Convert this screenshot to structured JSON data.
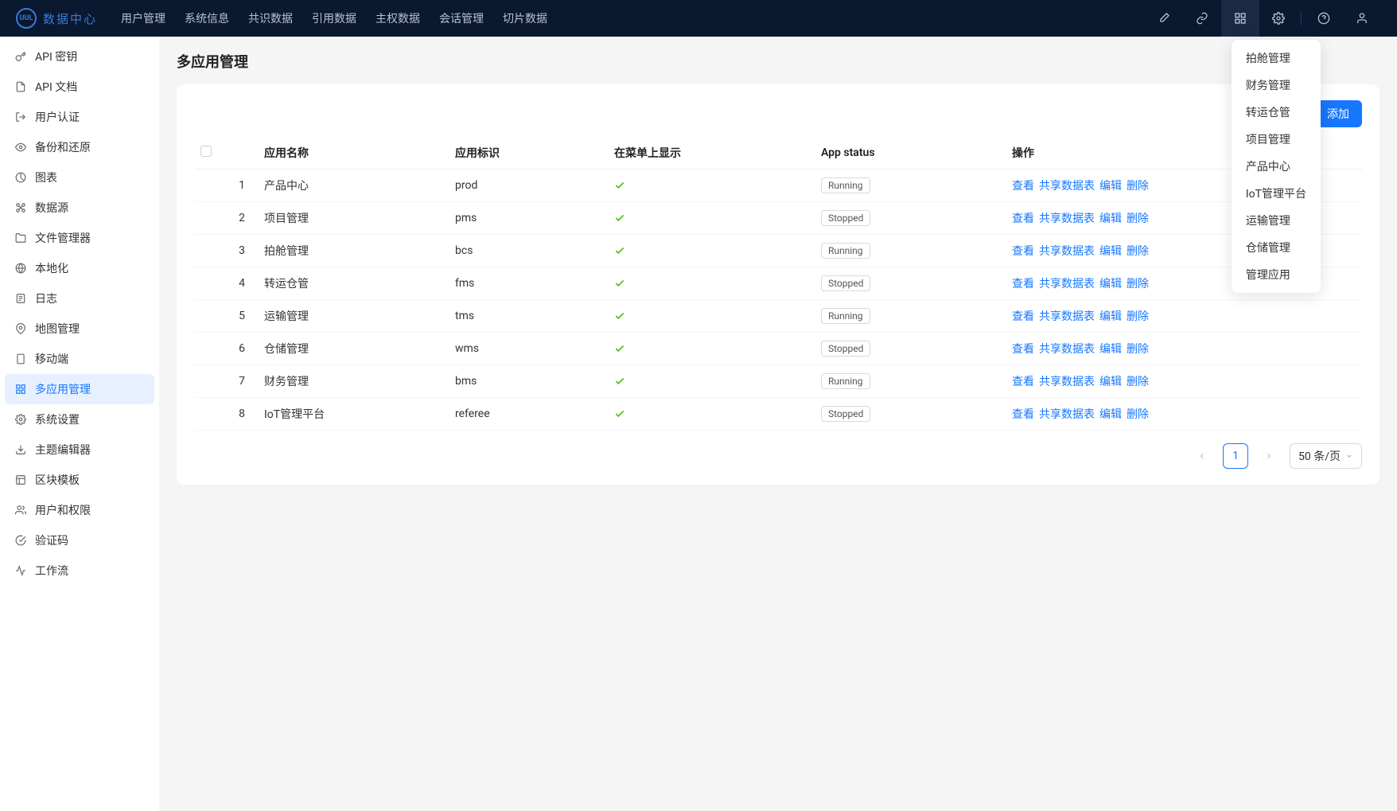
{
  "logo": {
    "badge": "UUL",
    "text": "数据中心"
  },
  "top_nav": [
    "用户管理",
    "系统信息",
    "共识数据",
    "引用数据",
    "主权数据",
    "会话管理",
    "切片数据"
  ],
  "sidebar": [
    {
      "icon": "key",
      "label": "API 密钥"
    },
    {
      "icon": "doc",
      "label": "API 文档"
    },
    {
      "icon": "exit",
      "label": "用户认证"
    },
    {
      "icon": "eye",
      "label": "备份和还原"
    },
    {
      "icon": "chart",
      "label": "图表"
    },
    {
      "icon": "nodes",
      "label": "数据源"
    },
    {
      "icon": "folder",
      "label": "文件管理器"
    },
    {
      "icon": "globe",
      "label": "本地化"
    },
    {
      "icon": "log",
      "label": "日志"
    },
    {
      "icon": "pin",
      "label": "地图管理"
    },
    {
      "icon": "phone",
      "label": "移动端"
    },
    {
      "icon": "grid",
      "label": "多应用管理",
      "active": true
    },
    {
      "icon": "gear",
      "label": "系统设置"
    },
    {
      "icon": "download",
      "label": "主题编辑器"
    },
    {
      "icon": "layout",
      "label": "区块模板"
    },
    {
      "icon": "users",
      "label": "用户和权限"
    },
    {
      "icon": "check",
      "label": "验证码"
    },
    {
      "icon": "flow",
      "label": "工作流"
    }
  ],
  "page_title": "多应用管理",
  "add_button": "添加",
  "columns": {
    "name": "应用名称",
    "tag": "应用标识",
    "show": "在菜单上显示",
    "status": "App status",
    "actions": "操作"
  },
  "rows": [
    {
      "idx": "1",
      "name": "产品中心",
      "tag": "prod",
      "show": true,
      "status": "Running"
    },
    {
      "idx": "2",
      "name": "项目管理",
      "tag": "pms",
      "show": true,
      "status": "Stopped"
    },
    {
      "idx": "3",
      "name": "拍舱管理",
      "tag": "bcs",
      "show": true,
      "status": "Running"
    },
    {
      "idx": "4",
      "name": "转运仓管",
      "tag": "fms",
      "show": true,
      "status": "Stopped"
    },
    {
      "idx": "5",
      "name": "运输管理",
      "tag": "tms",
      "show": true,
      "status": "Running"
    },
    {
      "idx": "6",
      "name": "仓储管理",
      "tag": "wms",
      "show": true,
      "status": "Stopped"
    },
    {
      "idx": "7",
      "name": "财务管理",
      "tag": "bms",
      "show": true,
      "status": "Running"
    },
    {
      "idx": "8",
      "name": "IoT管理平台",
      "tag": "referee",
      "show": true,
      "status": "Stopped"
    }
  ],
  "row_actions": {
    "view": "查看",
    "share": "共享数据表",
    "edit": "编辑",
    "delete": "删除"
  },
  "pagination": {
    "page": "1",
    "size": "50 条/页"
  },
  "dropdown": [
    "拍舱管理",
    "财务管理",
    "转运仓管",
    "项目管理",
    "产品中心",
    "IoT管理平台",
    "运输管理",
    "仓储管理",
    "管理应用"
  ]
}
